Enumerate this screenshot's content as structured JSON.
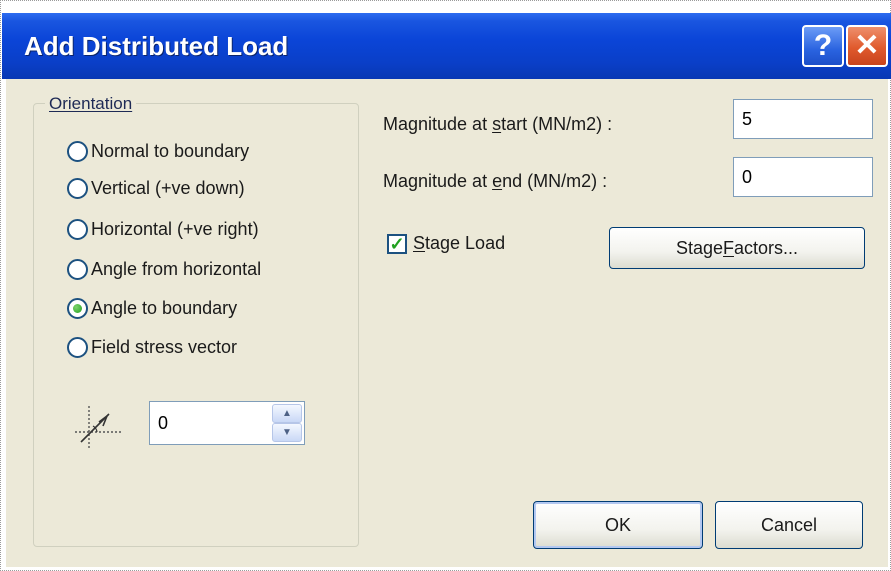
{
  "window": {
    "title": "Add Distributed Load",
    "help_label": "?",
    "close_label": "✕"
  },
  "orientation": {
    "legend": "Orientation",
    "options": [
      {
        "label": "Normal to boundary",
        "checked": false
      },
      {
        "label": "Vertical (+ve down)",
        "checked": false
      },
      {
        "label": "Horizontal (+ve right)",
        "checked": false
      },
      {
        "label": "Angle from horizontal",
        "checked": false
      },
      {
        "label": "Angle to boundary",
        "checked": true
      },
      {
        "label": "Field stress vector",
        "checked": false
      }
    ],
    "angle_icon": "angle-icon",
    "angle_value": "0"
  },
  "magnitude": {
    "start_label_pre": "Magnitude at ",
    "start_label_key": "s",
    "start_label_post": "tart (MN/m2) :",
    "start_value": "5",
    "end_label_pre": "Magnitude at ",
    "end_label_key": "e",
    "end_label_post": "nd (MN/m2) :",
    "end_value": "0"
  },
  "stage": {
    "checkbox_key": "S",
    "checkbox_rest": "tage Load",
    "checked": true,
    "factors_pre": "Stage ",
    "factors_key": "F",
    "factors_post": "actors..."
  },
  "buttons": {
    "ok": "OK",
    "cancel": "Cancel"
  },
  "colors": {
    "titlebar": "#0a3fc8",
    "dialog_bg": "#ece9d8",
    "accent_green": "#21a121"
  }
}
